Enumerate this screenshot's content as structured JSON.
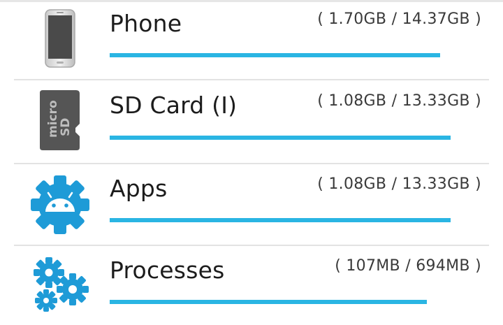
{
  "storage_items": [
    {
      "id": "phone",
      "title": "Phone",
      "size_text": "( 1.70GB / 14.37GB )",
      "used": "1.70GB",
      "total": "14.37GB",
      "icon": "phone-icon",
      "bar_fill": 0.97
    },
    {
      "id": "sdcard",
      "title": "SD Card (I)",
      "size_text": "( 1.08GB / 13.33GB )",
      "used": "1.08GB",
      "total": "13.33GB",
      "icon": "sd-card-icon",
      "bar_fill": 1.0
    },
    {
      "id": "apps",
      "title": "Apps",
      "size_text": "( 1.08GB / 13.33GB )",
      "used": "1.08GB",
      "total": "13.33GB",
      "icon": "android-gear-icon",
      "bar_fill": 1.0
    },
    {
      "id": "processes",
      "title": "Processes",
      "size_text": "( 107MB / 694MB )",
      "used": "107MB",
      "total": "694MB",
      "icon": "gears-icon",
      "bar_fill": 0.93
    }
  ],
  "colors": {
    "accent": "#2ab5e3",
    "icon_blue": "#1e9bd7",
    "text": "#1c1c1c",
    "divider": "#e3e3e3"
  }
}
